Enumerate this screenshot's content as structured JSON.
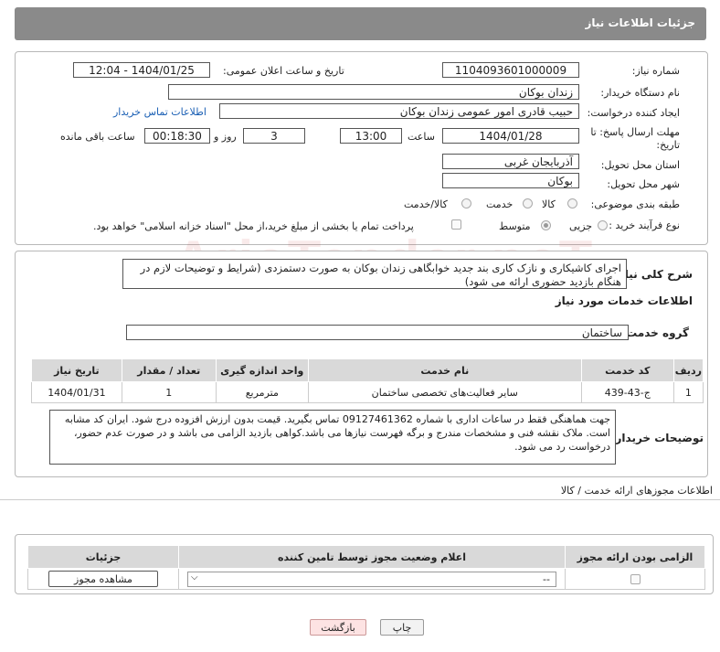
{
  "header": {
    "title": "جزئیات اطلاعات نیاز"
  },
  "form": {
    "need_number_label": "شماره نیاز:",
    "need_number": "1104093601000009",
    "announce_label": "تاریخ و ساعت اعلان عمومی:",
    "announce_value": "1404/01/25 - 12:04",
    "buyer_org_label": "نام دستگاه خریدار:",
    "buyer_org": "زندان بوکان",
    "creator_label": "ایجاد کننده درخواست:",
    "creator": "حبیب قادری امور عمومی  زندان بوکان",
    "contact_link": "اطلاعات تماس خریدار",
    "deadline_label_1": "مهلت ارسال پاسخ: تا",
    "deadline_label_2": "تاریخ:",
    "deadline_date": "1404/01/28",
    "time_label": "ساعت",
    "deadline_time": "13:00",
    "days_value": "3",
    "days_label": "روز و",
    "remaining_time": "00:18:30",
    "remaining_label": "ساعت باقی مانده",
    "province_label": "استان محل تحویل:",
    "province": "آذربایجان غربی",
    "city_label": "شهر محل تحویل:",
    "city": "بوکان",
    "category_label": "طبقه بندی موضوعی:",
    "category_options": [
      "کالا",
      "خدمت",
      "کالا/خدمت"
    ],
    "category_selected": "خدمت",
    "process_label": "نوع فرآیند خرید :",
    "process_options": [
      "جزیی",
      "متوسط"
    ],
    "process_selected": "جزیی",
    "payment_note": "پرداخت تمام یا بخشی از مبلغ خرید،از محل \"اسناد خزانه اسلامی\" خواهد بود."
  },
  "summary": {
    "label": "شرح کلی نیاز:",
    "text": "اجرای کاشیکاری و نازک کاری بند جدید خوابگاهی زندان بوکان به صورت دستمزدی (شرایط و توضیحات لازم در هنگام بازدید حضوری ارائه می شود)"
  },
  "services": {
    "title": "اطلاعات خدمات مورد نیاز",
    "group_label": "گروه خدمت:",
    "group_value": "ساختمان",
    "columns": [
      "ردیف",
      "کد خدمت",
      "نام خدمت",
      "واحد اندازه گیری",
      "تعداد / مقدار",
      "تاریخ نیاز"
    ],
    "rows": [
      [
        "1",
        "ج-43-439",
        "سایر فعالیت‌های تخصصی ساختمان",
        "مترمربع",
        "1",
        "1404/01/31"
      ]
    ]
  },
  "buyer_notes": {
    "label": "توضیحات خریدار:",
    "text": "جهت هماهنگی فقط در ساعات اداری با شماره 09127461362 تماس بگیرید. قیمت بدون ارزش افزوده درج شود. ایران کد مشابه است. ملاک نقشه فنی و مشخصات مندرج و برگه فهرست نیازها می باشد.کواهی بازدید الزامی می باشد و در صورت عدم حضور، درخواست رد می شود."
  },
  "permits": {
    "title": "اطلاعات مجوزهای ارائه خدمت / کالا",
    "columns": [
      "الزامی بودن ارائه مجوز",
      "اعلام وضعیت مجوز توسط تامین کننده",
      "جزئیات"
    ],
    "select_value": "--",
    "view_button": "مشاهده مجوز"
  },
  "footer": {
    "print_button": "چاپ",
    "back_button": "بازگشت"
  },
  "watermark": "AriaTender.neT",
  "colors": {
    "header_bg": "#8a8a8a",
    "link": "#1a5fb4",
    "back_button_bg": "#fde3e3"
  }
}
